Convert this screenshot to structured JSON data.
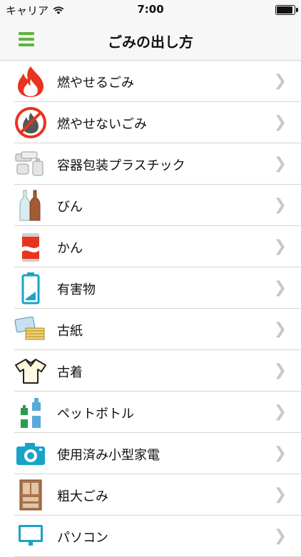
{
  "status_bar": {
    "carrier": "キャリア",
    "time": "7:00"
  },
  "nav": {
    "title": "ごみの出し方"
  },
  "items": [
    {
      "label": "燃やせるごみ",
      "icon": "fire-icon"
    },
    {
      "label": "燃やせないごみ",
      "icon": "no-fire-icon"
    },
    {
      "label": "容器包装プラスチック",
      "icon": "plastic-container-icon"
    },
    {
      "label": "びん",
      "icon": "bottle-icon"
    },
    {
      "label": "かん",
      "icon": "can-icon"
    },
    {
      "label": "有害物",
      "icon": "battery-icon"
    },
    {
      "label": "古紙",
      "icon": "paper-icon"
    },
    {
      "label": "古着",
      "icon": "shirt-icon"
    },
    {
      "label": "ペットボトル",
      "icon": "pet-bottle-icon"
    },
    {
      "label": "使用済み小型家電",
      "icon": "camera-icon"
    },
    {
      "label": "粗大ごみ",
      "icon": "cabinet-icon"
    },
    {
      "label": "パソコン",
      "icon": "computer-icon"
    }
  ],
  "colors": {
    "accent": "#5db538",
    "fire": "#e8331f",
    "teal": "#1aa3c7"
  }
}
